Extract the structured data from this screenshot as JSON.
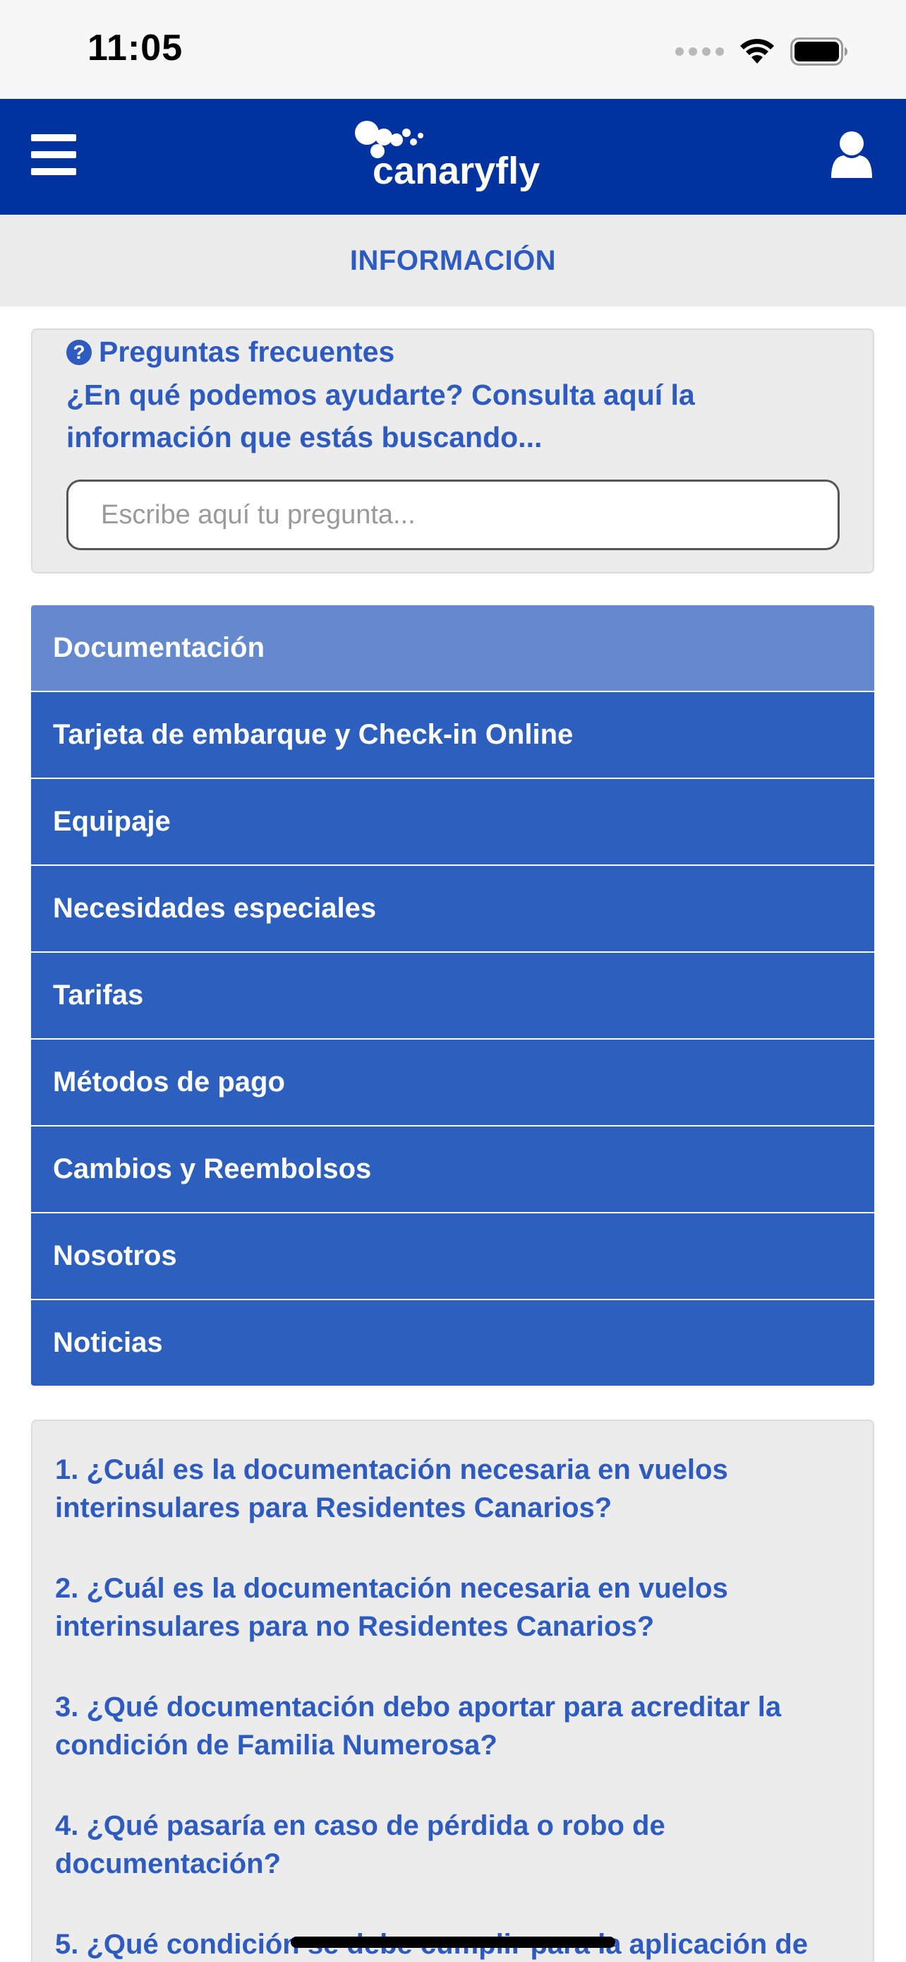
{
  "status_bar": {
    "time": "11:05",
    "icons": [
      "signal-icon",
      "wifi-icon",
      "battery-icon"
    ]
  },
  "header": {
    "logo_text": "canaryfly",
    "menu_icon": "hamburger-icon",
    "user_icon": "user-icon",
    "brand_color": "#0033a0"
  },
  "section": {
    "title": "INFORMACIÓN"
  },
  "faq": {
    "icon": "question-circle-icon",
    "title": "Preguntas frecuentes",
    "subtitle": "¿En qué podemos ayudarte? Consulta aquí la información que estás buscando...",
    "search_placeholder": "Escribe aquí tu pregunta...",
    "search_value": ""
  },
  "categories": [
    {
      "label": "Documentación",
      "active": true
    },
    {
      "label": "Tarjeta de embarque y Check-in Online",
      "active": false
    },
    {
      "label": "Equipaje",
      "active": false
    },
    {
      "label": "Necesidades especiales",
      "active": false
    },
    {
      "label": "Tarifas",
      "active": false
    },
    {
      "label": "Métodos de pago",
      "active": false
    },
    {
      "label": "Cambios y Reembolsos",
      "active": false
    },
    {
      "label": "Nosotros",
      "active": false
    },
    {
      "label": "Noticias",
      "active": false
    }
  ],
  "questions": [
    "1. ¿Cuál es la documentación necesaria en vuelos interinsulares para Residentes Canarios?",
    "2. ¿Cuál es la documentación necesaria en vuelos interinsulares para no Residentes Canarios?",
    "3. ¿Qué documentación debo aportar para acreditar la condición de Familia Numerosa?",
    "4. ¿Qué pasaría en caso de pérdida o robo de documentación?",
    "5. ¿Qué condición se debe cumplir para la aplicación de"
  ],
  "colors": {
    "accent": "#2d5bbf",
    "category_bg": "#2d5fbf",
    "category_active_bg": "#6589cf",
    "panel_bg": "#ececec"
  }
}
